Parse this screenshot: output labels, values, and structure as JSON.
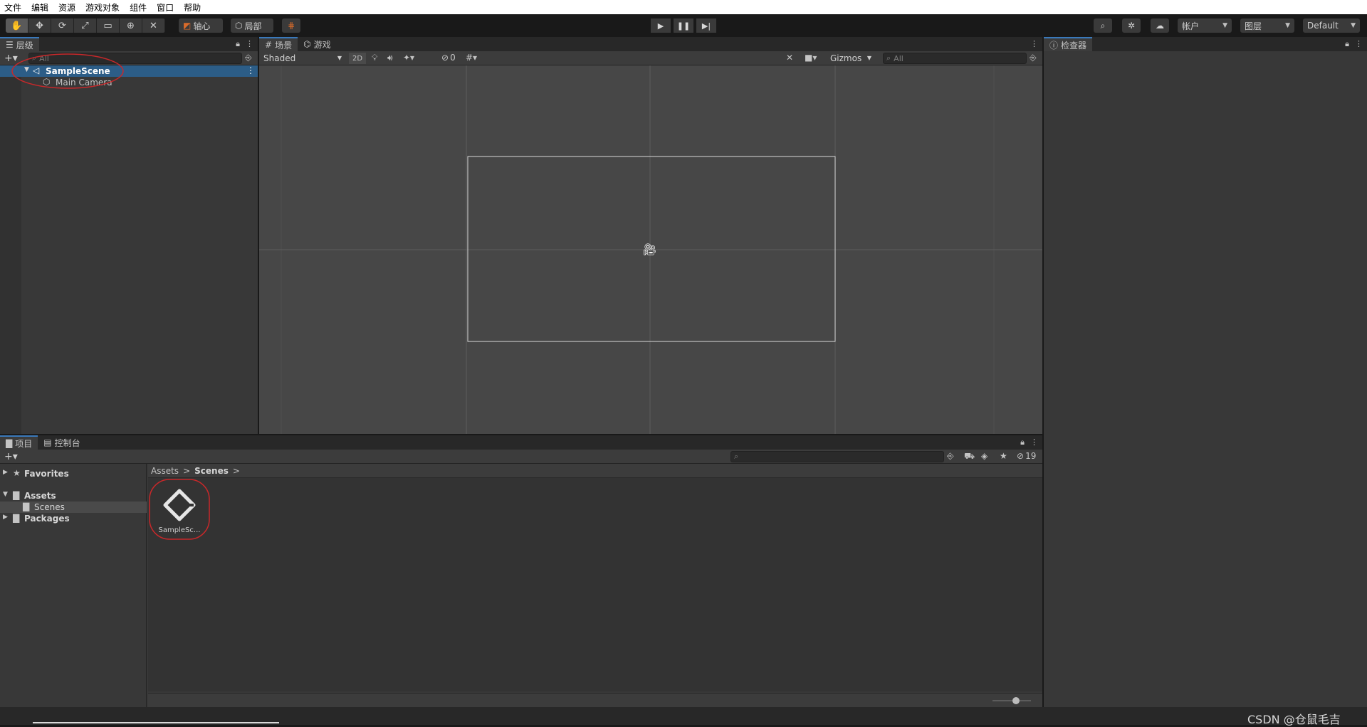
{
  "menubar": {
    "items": [
      "文件",
      "编辑",
      "资源",
      "游戏对象",
      "组件",
      "窗口",
      "帮助"
    ]
  },
  "toolbar": {
    "pivot_label": "轴心",
    "local_label": "局部",
    "account_label": "帐户",
    "layers_label": "图层",
    "layout_label": "Default"
  },
  "hierarchy": {
    "tab_label": "层级",
    "search_placeholder": "All",
    "scene_name": "SampleScene",
    "objects": [
      "Main Camera"
    ]
  },
  "scene_view": {
    "tabs": [
      "场景",
      "游戏"
    ],
    "shading_mode": "Shaded",
    "mode_2d": "2D",
    "hidden_count": "0",
    "gizmos_label": "Gizmos",
    "search_placeholder": "All"
  },
  "inspector": {
    "tab_label": "检查器"
  },
  "project": {
    "tabs": [
      "项目",
      "控制台"
    ],
    "hidden_count": "19",
    "tree": {
      "favorites": "Favorites",
      "assets": "Assets",
      "scenes": "Scenes",
      "packages": "Packages"
    },
    "breadcrumb": [
      "Assets",
      "Scenes"
    ],
    "asset_items": [
      "SampleSc..."
    ]
  },
  "watermark": "CSDN @仓鼠毛吉",
  "colors": {
    "selection": "#2c5d87",
    "annotation": "#c8282a",
    "panel": "#383838",
    "scene_bg": "#474747"
  }
}
